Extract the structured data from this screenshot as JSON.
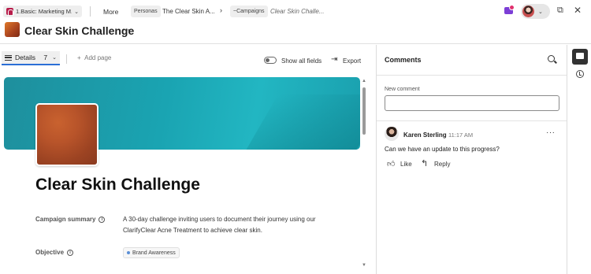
{
  "topbar": {
    "workspace_label": "1.Basic: Marketing M...",
    "more_label": "More",
    "crumb_personas": "Personas",
    "crumb_persona_name": "The Clear Skin A...",
    "crumb_campaigns": "~Campaigns",
    "crumb_current": "Clear Skin Challe..."
  },
  "record": {
    "title": "Clear Skin Challenge"
  },
  "toolbar": {
    "details_label": "Details",
    "details_count": "7",
    "add_page_label": "Add page",
    "show_all_label": "Show all fields",
    "export_label": "Export"
  },
  "content": {
    "heading": "Clear Skin Challenge",
    "campaign_summary_label": "Campaign summary",
    "campaign_summary_value": "A 30-day challenge inviting users to document their journey using our ClarifyClear Acne Treatment to achieve clear skin.",
    "objective_label": "Objective",
    "objective_tag": "Brand Awareness"
  },
  "comments": {
    "title": "Comments",
    "new_comment_label": "New comment",
    "items": [
      {
        "author": "Karen Sterling",
        "time": "11:17 AM",
        "text": "Can we have an update to this progress?",
        "like_label": "Like",
        "reply_label": "Reply"
      }
    ]
  },
  "icons": {
    "info": "info-icon",
    "search": "search-icon",
    "export": "export-icon",
    "like": "thumbs-up-icon",
    "reply": "reply-arrow-icon",
    "comments_rail": "comment-bubble-icon",
    "history_rail": "clock-icon"
  },
  "colors": {
    "banner_teal": "#1aa4b2",
    "accent_blue": "#2b6fd6",
    "brand_purple": "#7c3ed6"
  }
}
